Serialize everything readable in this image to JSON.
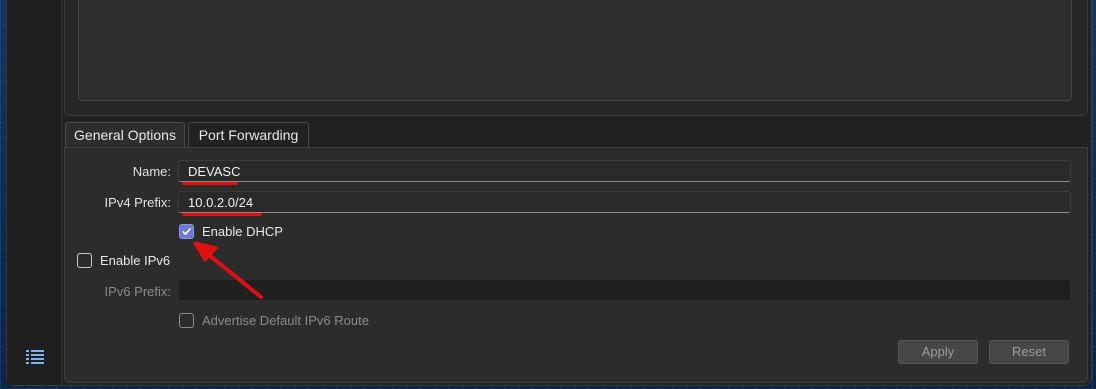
{
  "tabs": [
    {
      "label": "General Options",
      "active": true
    },
    {
      "label": "Port Forwarding",
      "active": false
    }
  ],
  "form": {
    "name_label": "Name:",
    "name_value": "DEVASC",
    "ipv4_label": "IPv4 Prefix:",
    "ipv4_value": "10.0.2.0/24",
    "dhcp_label": "Enable DHCP",
    "dhcp_checked": true,
    "ipv6_label": "Enable IPv6",
    "ipv6_checked": false,
    "ipv6_prefix_label": "IPv6 Prefix:",
    "ipv6_prefix_value": "",
    "advertise_label": "Advertise Default IPv6 Route",
    "advertise_checked": false
  },
  "buttons": {
    "apply": "Apply",
    "reset": "Reset"
  },
  "icons": {
    "sidebar": "list-view-icon",
    "check": "checkmark-icon"
  },
  "colors": {
    "annotation": "#e01010",
    "checkbox_accent": "#6b78d8",
    "sidebar_icon": "#7fb2ea"
  }
}
